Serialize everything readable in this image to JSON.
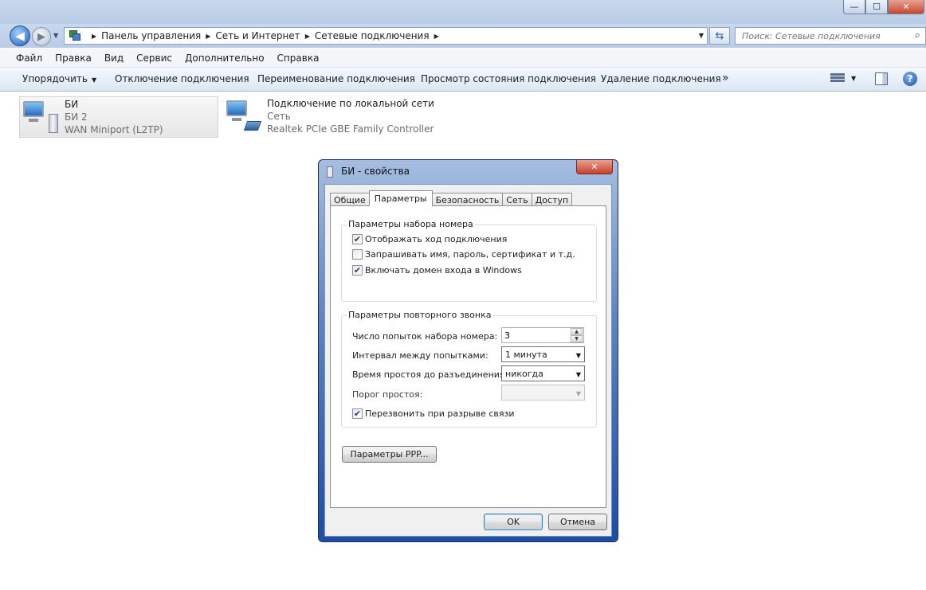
{
  "window": {
    "min_glyph": "—",
    "max_glyph": "☐",
    "close_glyph": "✕"
  },
  "address": {
    "back_glyph": "◀",
    "fwd_glyph": "▶",
    "crumbs": [
      "Панель управления",
      "Сеть и Интернет",
      "Сетевые подключения"
    ],
    "refresh_glyph": "⇆",
    "search_placeholder": "Поиск: Сетевые подключения",
    "search_glyph": "⌕"
  },
  "menu": {
    "items": [
      "Файл",
      "Правка",
      "Вид",
      "Сервис",
      "Дополнительно",
      "Справка"
    ]
  },
  "toolbar": {
    "organize": "Упорядочить",
    "disconnect": "Отключение подключения",
    "rename": "Переименование подключения",
    "status": "Просмотр состояния подключения",
    "delete": "Удаление подключения",
    "more": "»",
    "help_glyph": "?"
  },
  "connections": [
    {
      "name": "БИ",
      "line2": "БИ 2",
      "line3": "WAN Miniport (L2TP)"
    },
    {
      "name": "Подключение по локальной сети",
      "line2": "Сеть",
      "line3": "Realtek PCIe GBE Family Controller"
    }
  ],
  "dialog": {
    "title": "БИ - свойства",
    "close_glyph": "✕",
    "tabs": [
      "Общие",
      "Параметры",
      "Безопасность",
      "Сеть",
      "Доступ"
    ],
    "active_tab": "Параметры",
    "dial_group": {
      "title": "Параметры набора номера",
      "options": [
        {
          "label": "Отображать ход подключения",
          "checked": true
        },
        {
          "label": "Запрашивать имя, пароль, сертификат и т.д.",
          "checked": false
        },
        {
          "label": "Включать домен входа в Windows",
          "checked": true
        }
      ]
    },
    "redial_group": {
      "title": "Параметры повторного звонка",
      "attempts_label": "Число попыток набора номера:",
      "attempts_value": "3",
      "interval_label": "Интервал между попытками:",
      "interval_value": "1 минута",
      "idle_label": "Время простоя до разъединения:",
      "idle_value": "никогда",
      "threshold_label": "Порог простоя:",
      "threshold_value": "",
      "redial_label": "Перезвонить при разрыве связи",
      "redial_checked": true
    },
    "ppp_button": "Параметры PPP...",
    "ok_button": "OK",
    "cancel_button": "Отмена",
    "check_glyph": "✔",
    "spin_up": "▲",
    "spin_down": "▼",
    "combo_arrow": "▼"
  }
}
